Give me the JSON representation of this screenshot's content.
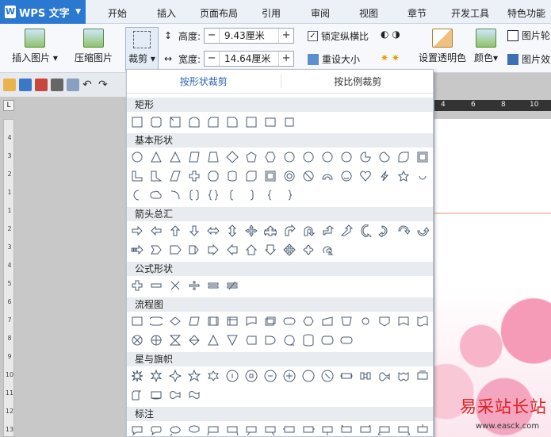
{
  "app": {
    "title": "WPS 文字",
    "logo": "W"
  },
  "menu_tabs": [
    "开始",
    "插入",
    "页面布局",
    "引用",
    "审阅",
    "视图",
    "章节",
    "开发工具",
    "特色功能"
  ],
  "ribbon": {
    "insert_picture": "插入图片",
    "compress_picture": "压缩图片",
    "crop": "裁剪",
    "height_label": "高度:",
    "height_value": "9.43厘米",
    "width_label": "宽度:",
    "width_value": "14.64厘米",
    "lock_ratio": "锁定纵横比",
    "reset_size": "重设大小",
    "set_transparent": "设置透明色",
    "color": "颜色",
    "picture_outline": "图片轮",
    "picture_effect": "图片效"
  },
  "crop_panel": {
    "tabs": [
      "按形状裁剪",
      "按比例裁剪"
    ],
    "sections": [
      "矩形",
      "基本形状",
      "箭头总汇",
      "公式形状",
      "流程图",
      "星与旗帜",
      "标注"
    ]
  },
  "ruler": {
    "corner": "L",
    "h_ticks": [
      "4",
      "6",
      "8",
      "10"
    ],
    "v_ticks": [
      "4",
      "3",
      "2",
      "1",
      "1",
      "2",
      "3",
      "4",
      "5",
      "6",
      "7",
      "8",
      "9",
      "10",
      "11",
      "12",
      "13"
    ]
  },
  "watermark": {
    "text": "易采站长站",
    "url": "www.easck.com"
  },
  "colors": {
    "accent": "#2b78d0",
    "active_tab": "#2a63b8"
  }
}
